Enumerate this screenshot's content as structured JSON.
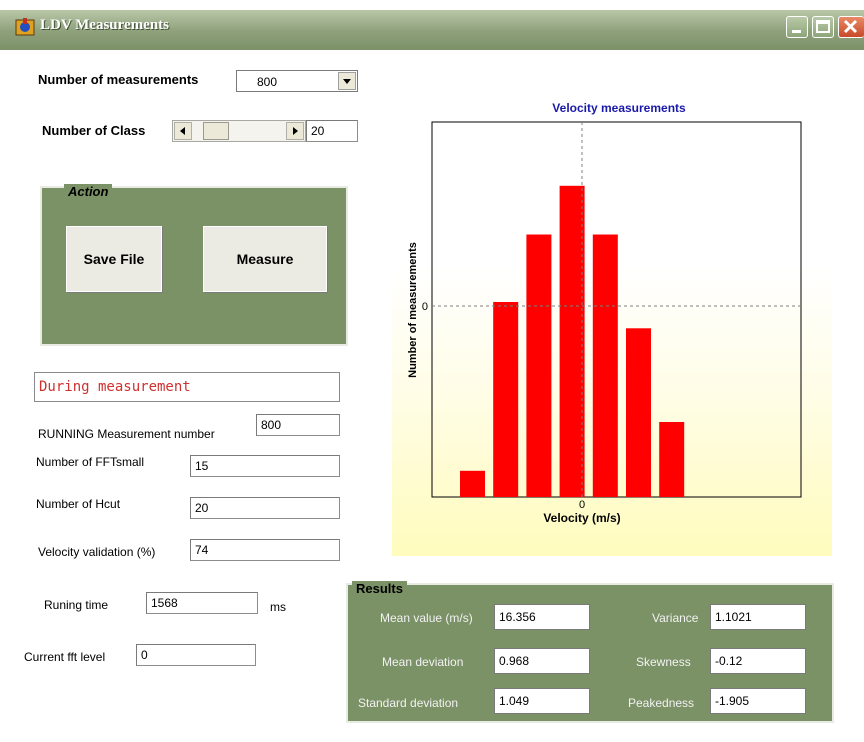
{
  "window": {
    "title": "LDV Measurements"
  },
  "controls": {
    "num_measurements_label": "Number of measurements",
    "num_measurements_value": "800",
    "num_class_label": "Number of Class",
    "num_class_value": "20"
  },
  "action": {
    "legend": "Action",
    "save_label": "Save File",
    "measure_label": "Measure"
  },
  "status": {
    "text": "During measurement"
  },
  "fields": {
    "running_label": "RUNNING Measurement number",
    "running_value": "800",
    "fft_label": "Number of FFTsmall",
    "fft_value": "15",
    "hcut_label": "Number of Hcut",
    "hcut_value": "20",
    "validation_label": "Velocity validation (%)",
    "validation_value": "74",
    "runtime_label": "Runing time",
    "runtime_value": "1568",
    "runtime_unit": "ms",
    "fft_level_label": "Current fft level",
    "fft_level_value": "0"
  },
  "results": {
    "legend": "Results",
    "mean_label": "Mean value (m/s)",
    "mean_value": "16.356",
    "mean_dev_label": "Mean deviation",
    "mean_dev_value": "0.968",
    "std_label": "Standard deviation",
    "std_value": "1.049",
    "variance_label": "Variance",
    "variance_value": "1.1021",
    "skewness_label": "Skewness",
    "skewness_value": "-0.12",
    "peakedness_label": "Peakedness",
    "peakedness_value": "-1.905"
  },
  "chart_data": {
    "type": "bar",
    "title": "Velocity measurements",
    "xlabel": "Velocity (m/s)",
    "ylabel": "Number of measurements",
    "x_tick_labels": [
      "0"
    ],
    "y_tick_labels": [
      "0"
    ],
    "values": [
      7,
      52,
      70,
      83,
      70,
      45,
      20
    ],
    "ylim": [
      0,
      100
    ],
    "bar_color": "#ff0000",
    "title_color": "#1a1aaa"
  },
  "colors": {
    "frame": "#6f8a5f",
    "group_fill": "#7b9166",
    "status_text": "#d03030"
  },
  "icons": {
    "app": "app-logo-icon",
    "minimize": "minimize-icon",
    "maximize": "maximize-icon",
    "close": "close-icon"
  }
}
